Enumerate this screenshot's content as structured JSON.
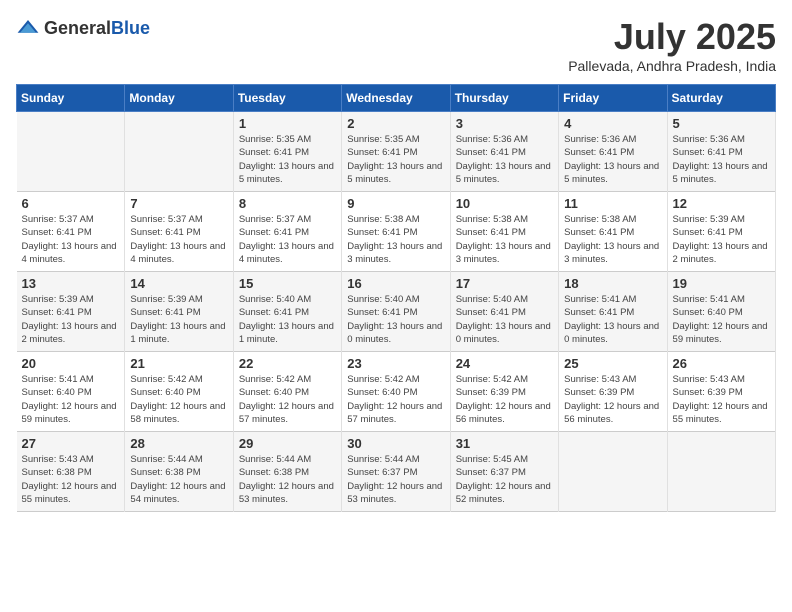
{
  "header": {
    "logo_general": "General",
    "logo_blue": "Blue",
    "month_title": "July 2025",
    "location": "Pallevada, Andhra Pradesh, India"
  },
  "days_of_week": [
    "Sunday",
    "Monday",
    "Tuesday",
    "Wednesday",
    "Thursday",
    "Friday",
    "Saturday"
  ],
  "weeks": [
    [
      {
        "day": "",
        "info": ""
      },
      {
        "day": "",
        "info": ""
      },
      {
        "day": "1",
        "info": "Sunrise: 5:35 AM\nSunset: 6:41 PM\nDaylight: 13 hours and 5 minutes."
      },
      {
        "day": "2",
        "info": "Sunrise: 5:35 AM\nSunset: 6:41 PM\nDaylight: 13 hours and 5 minutes."
      },
      {
        "day": "3",
        "info": "Sunrise: 5:36 AM\nSunset: 6:41 PM\nDaylight: 13 hours and 5 minutes."
      },
      {
        "day": "4",
        "info": "Sunrise: 5:36 AM\nSunset: 6:41 PM\nDaylight: 13 hours and 5 minutes."
      },
      {
        "day": "5",
        "info": "Sunrise: 5:36 AM\nSunset: 6:41 PM\nDaylight: 13 hours and 5 minutes."
      }
    ],
    [
      {
        "day": "6",
        "info": "Sunrise: 5:37 AM\nSunset: 6:41 PM\nDaylight: 13 hours and 4 minutes."
      },
      {
        "day": "7",
        "info": "Sunrise: 5:37 AM\nSunset: 6:41 PM\nDaylight: 13 hours and 4 minutes."
      },
      {
        "day": "8",
        "info": "Sunrise: 5:37 AM\nSunset: 6:41 PM\nDaylight: 13 hours and 4 minutes."
      },
      {
        "day": "9",
        "info": "Sunrise: 5:38 AM\nSunset: 6:41 PM\nDaylight: 13 hours and 3 minutes."
      },
      {
        "day": "10",
        "info": "Sunrise: 5:38 AM\nSunset: 6:41 PM\nDaylight: 13 hours and 3 minutes."
      },
      {
        "day": "11",
        "info": "Sunrise: 5:38 AM\nSunset: 6:41 PM\nDaylight: 13 hours and 3 minutes."
      },
      {
        "day": "12",
        "info": "Sunrise: 5:39 AM\nSunset: 6:41 PM\nDaylight: 13 hours and 2 minutes."
      }
    ],
    [
      {
        "day": "13",
        "info": "Sunrise: 5:39 AM\nSunset: 6:41 PM\nDaylight: 13 hours and 2 minutes."
      },
      {
        "day": "14",
        "info": "Sunrise: 5:39 AM\nSunset: 6:41 PM\nDaylight: 13 hours and 1 minute."
      },
      {
        "day": "15",
        "info": "Sunrise: 5:40 AM\nSunset: 6:41 PM\nDaylight: 13 hours and 1 minute."
      },
      {
        "day": "16",
        "info": "Sunrise: 5:40 AM\nSunset: 6:41 PM\nDaylight: 13 hours and 0 minutes."
      },
      {
        "day": "17",
        "info": "Sunrise: 5:40 AM\nSunset: 6:41 PM\nDaylight: 13 hours and 0 minutes."
      },
      {
        "day": "18",
        "info": "Sunrise: 5:41 AM\nSunset: 6:41 PM\nDaylight: 13 hours and 0 minutes."
      },
      {
        "day": "19",
        "info": "Sunrise: 5:41 AM\nSunset: 6:40 PM\nDaylight: 12 hours and 59 minutes."
      }
    ],
    [
      {
        "day": "20",
        "info": "Sunrise: 5:41 AM\nSunset: 6:40 PM\nDaylight: 12 hours and 59 minutes."
      },
      {
        "day": "21",
        "info": "Sunrise: 5:42 AM\nSunset: 6:40 PM\nDaylight: 12 hours and 58 minutes."
      },
      {
        "day": "22",
        "info": "Sunrise: 5:42 AM\nSunset: 6:40 PM\nDaylight: 12 hours and 57 minutes."
      },
      {
        "day": "23",
        "info": "Sunrise: 5:42 AM\nSunset: 6:40 PM\nDaylight: 12 hours and 57 minutes."
      },
      {
        "day": "24",
        "info": "Sunrise: 5:42 AM\nSunset: 6:39 PM\nDaylight: 12 hours and 56 minutes."
      },
      {
        "day": "25",
        "info": "Sunrise: 5:43 AM\nSunset: 6:39 PM\nDaylight: 12 hours and 56 minutes."
      },
      {
        "day": "26",
        "info": "Sunrise: 5:43 AM\nSunset: 6:39 PM\nDaylight: 12 hours and 55 minutes."
      }
    ],
    [
      {
        "day": "27",
        "info": "Sunrise: 5:43 AM\nSunset: 6:38 PM\nDaylight: 12 hours and 55 minutes."
      },
      {
        "day": "28",
        "info": "Sunrise: 5:44 AM\nSunset: 6:38 PM\nDaylight: 12 hours and 54 minutes."
      },
      {
        "day": "29",
        "info": "Sunrise: 5:44 AM\nSunset: 6:38 PM\nDaylight: 12 hours and 53 minutes."
      },
      {
        "day": "30",
        "info": "Sunrise: 5:44 AM\nSunset: 6:37 PM\nDaylight: 12 hours and 53 minutes."
      },
      {
        "day": "31",
        "info": "Sunrise: 5:45 AM\nSunset: 6:37 PM\nDaylight: 12 hours and 52 minutes."
      },
      {
        "day": "",
        "info": ""
      },
      {
        "day": "",
        "info": ""
      }
    ]
  ]
}
